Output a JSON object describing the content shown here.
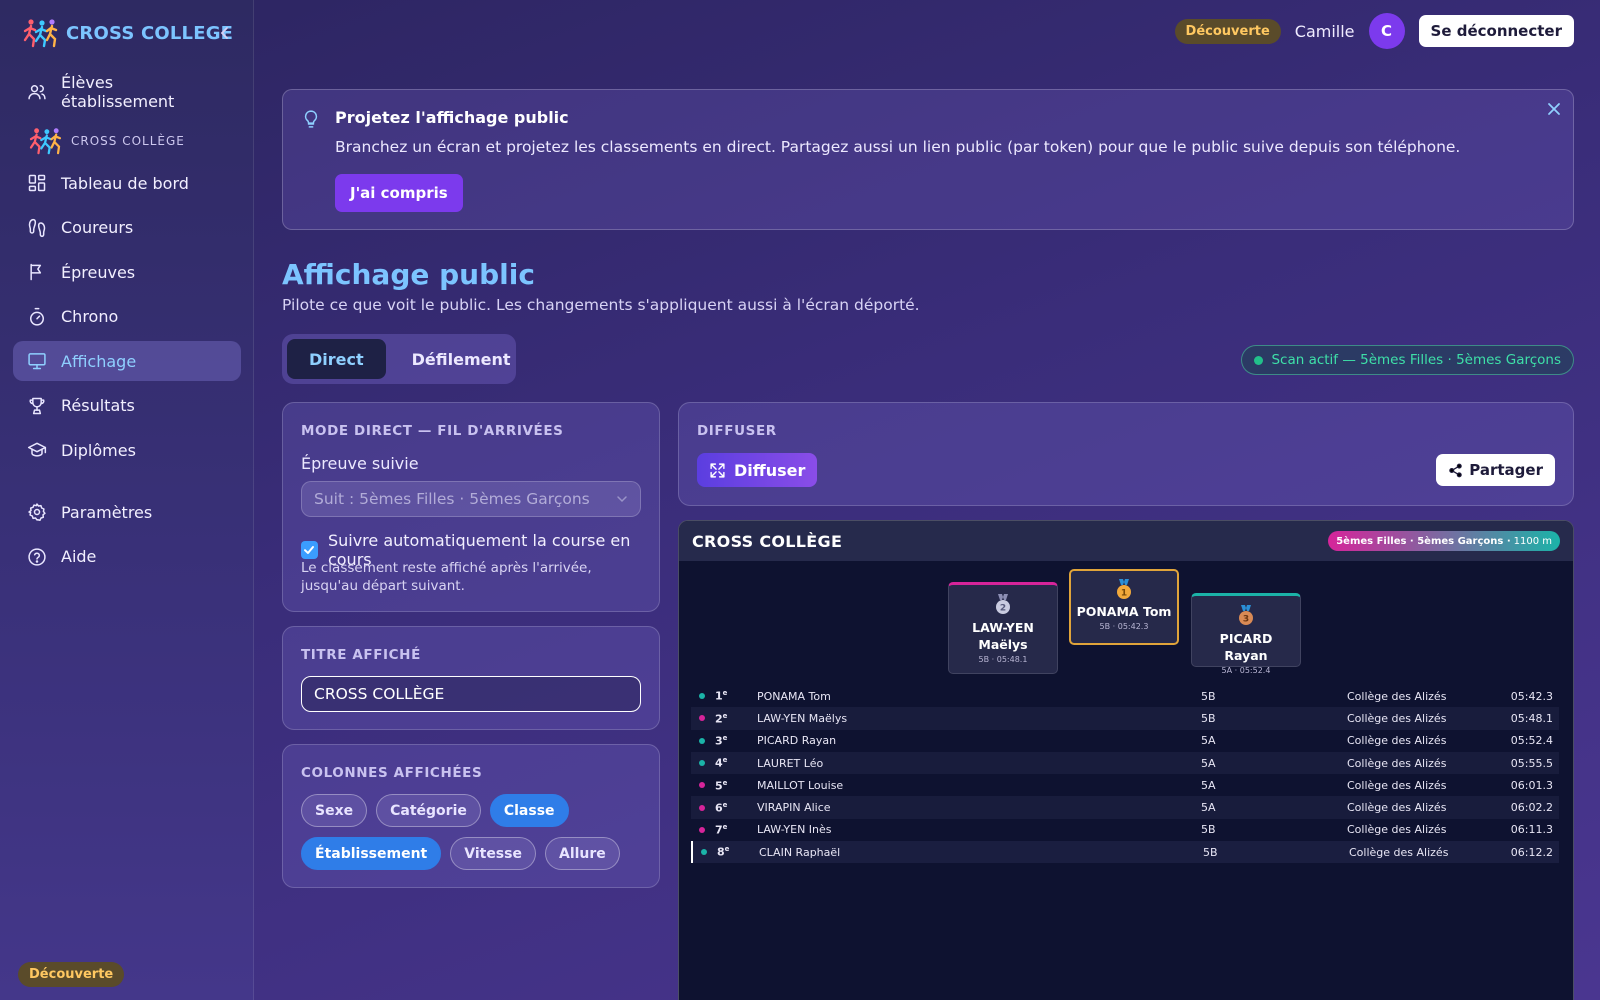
{
  "brand": {
    "title": "CROSS COLLEGE"
  },
  "sidebar": {
    "item_students": "Élèves établissement",
    "section_label": "CROSS COLLÈGE",
    "items": [
      {
        "label": "Tableau de bord",
        "icon": "dashboard-icon"
      },
      {
        "label": "Coureurs",
        "icon": "footprints-icon"
      },
      {
        "label": "Épreuves",
        "icon": "flag-icon"
      },
      {
        "label": "Chrono",
        "icon": "stopwatch-icon"
      },
      {
        "label": "Affichage",
        "icon": "monitor-icon",
        "active": true
      },
      {
        "label": "Résultats",
        "icon": "trophy-icon"
      },
      {
        "label": "Diplômes",
        "icon": "graduation-cap-icon"
      }
    ],
    "settings": "Paramètres",
    "help": "Aide",
    "badge": "Découverte"
  },
  "header": {
    "badge": "Découverte",
    "username": "Camille",
    "avatar_initial": "C",
    "logout": "Se déconnecter"
  },
  "banner": {
    "title": "Projetez l'affichage public",
    "text": "Branchez un écran et projetez les classements en direct. Partagez aussi un lien public (par token) pour que le public suive depuis son téléphone.",
    "button": "J'ai compris"
  },
  "page": {
    "title": "Affichage public",
    "subtitle": "Pilote ce que voit le public. Les changements s'appliquent aussi à l'écran déporté."
  },
  "tabs": [
    {
      "label": "Direct",
      "active": true
    },
    {
      "label": "Défilement",
      "active": false
    }
  ],
  "scan_status": "Scan actif — 5èmes Filles · 5èmes Garçons",
  "direct_mode": {
    "label": "MODE DIRECT — FIL D'ARRIVÉES",
    "field_label": "Épreuve suivie",
    "select_value": "Suit : 5èmes Filles · 5èmes Garçons",
    "checkbox_label": "Suivre automatiquement la course en cours",
    "checkbox_checked": true,
    "hint": "Le classement reste affiché après l'arrivée, jusqu'au départ suivant."
  },
  "title_card": {
    "label": "TITRE AFFICHÉ",
    "value": "CROSS COLLÈGE"
  },
  "columns_card": {
    "label": "COLONNES AFFICHÉES",
    "chips": [
      {
        "label": "Sexe",
        "on": false
      },
      {
        "label": "Catégorie",
        "on": false
      },
      {
        "label": "Classe",
        "on": true
      },
      {
        "label": "Établissement",
        "on": true
      },
      {
        "label": "Vitesse",
        "on": false
      },
      {
        "label": "Allure",
        "on": false
      }
    ]
  },
  "diffuser_card": {
    "label": "DIFFUSER",
    "button": "Diffuser",
    "share": "Partager"
  },
  "board": {
    "title": "CROSS COLLÈGE",
    "race": "5èmes Filles · 5èmes Garçons ·",
    "distance": "1100 m",
    "podium": [
      {
        "place": "2",
        "name": "LAW-YEN Maëlys",
        "meta": "5B · 05:48.1"
      },
      {
        "place": "1",
        "name": "PONAMA Tom",
        "meta": "5B · 05:42.3"
      },
      {
        "place": "3",
        "name": "PICARD Rayan",
        "meta": "5A · 05:52.4"
      }
    ],
    "rows": [
      {
        "rank": "1",
        "suffix": "e",
        "name": "PONAMA Tom",
        "classe": "5B",
        "etab": "Collège des Alizés",
        "time": "05:42.3",
        "sex": "M"
      },
      {
        "rank": "2",
        "suffix": "e",
        "name": "LAW-YEN Maëlys",
        "classe": "5B",
        "etab": "Collège des Alizés",
        "time": "05:48.1",
        "sex": "F"
      },
      {
        "rank": "3",
        "suffix": "e",
        "name": "PICARD Rayan",
        "classe": "5A",
        "etab": "Collège des Alizés",
        "time": "05:52.4",
        "sex": "M"
      },
      {
        "rank": "4",
        "suffix": "e",
        "name": "LAURET Léo",
        "classe": "5A",
        "etab": "Collège des Alizés",
        "time": "05:55.5",
        "sex": "M"
      },
      {
        "rank": "5",
        "suffix": "e",
        "name": "MAILLOT Louise",
        "classe": "5A",
        "etab": "Collège des Alizés",
        "time": "06:01.3",
        "sex": "F"
      },
      {
        "rank": "6",
        "suffix": "e",
        "name": "VIRAPIN Alice",
        "classe": "5A",
        "etab": "Collège des Alizés",
        "time": "06:02.2",
        "sex": "F"
      },
      {
        "rank": "7",
        "suffix": "e",
        "name": "LAW-YEN Inès",
        "classe": "5B",
        "etab": "Collège des Alizés",
        "time": "06:11.3",
        "sex": "F"
      },
      {
        "rank": "8",
        "suffix": "e",
        "name": "CLAIN Raphaël",
        "classe": "5B",
        "etab": "Collège des Alizés",
        "time": "06:12.2",
        "sex": "M"
      }
    ]
  },
  "colors": {
    "accent": "#7cc4ff",
    "primary": "#7c3aed",
    "chip_on": "#2f7de8",
    "female": "#d6249a",
    "male": "#1bb3a8",
    "gold": "#e0a43a",
    "scan": "#3ee0a8"
  }
}
